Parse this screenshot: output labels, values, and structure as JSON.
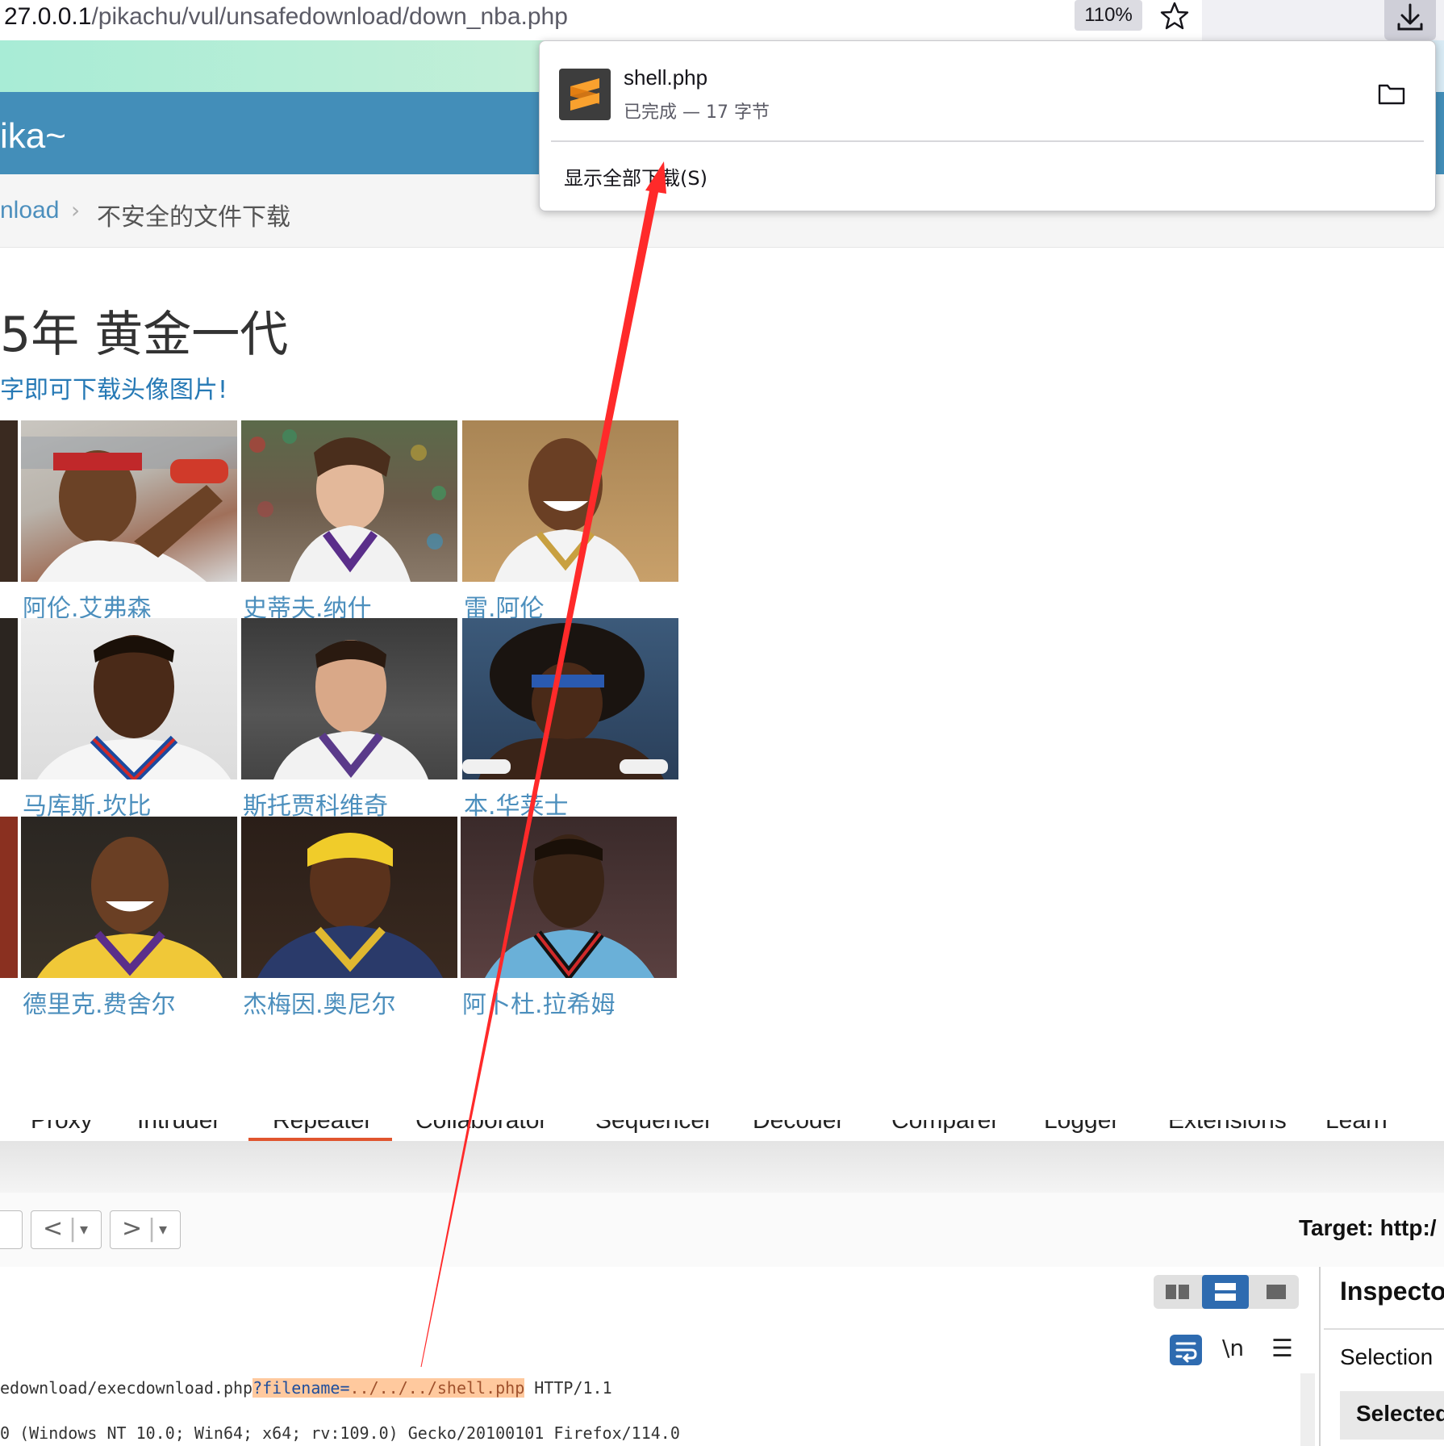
{
  "browser": {
    "url_host": "27.0.0.1",
    "url_path": "/pikachu/vul/unsafedownload/down_nba.php",
    "zoom": "110%",
    "icons": [
      "star-icon",
      "download-icon"
    ]
  },
  "downloads_panel": {
    "file_name": "shell.php",
    "status": "已完成 — 17 字节",
    "show_all": "显示全部下载(S)",
    "icons": [
      "sublime-text-icon",
      "folder-icon"
    ]
  },
  "page": {
    "brand": "ika~",
    "breadcrumb": {
      "parent": "nload",
      "current": "不安全的文件下载"
    },
    "heading": "5年 黄金一代",
    "hint": "字即可下载头像图片!",
    "players": [
      {
        "name": "阿伦.艾弗森"
      },
      {
        "name": "史蒂夫.纳什"
      },
      {
        "name": "雷.阿伦"
      },
      {
        "name": "马库斯.坎比"
      },
      {
        "name": "斯托贾科维奇"
      },
      {
        "name": "本.华莱士"
      },
      {
        "name": "德里克.费舍尔"
      },
      {
        "name": "杰梅因.奥尼尔"
      },
      {
        "name": "阿卜杜.拉希姆"
      }
    ]
  },
  "burp": {
    "tabs": [
      "Proxy",
      "Intruder",
      "Repeater",
      "Collaborator",
      "Sequencer",
      "Decoder",
      "Comparer",
      "Logger",
      "Extensions",
      "Learn"
    ],
    "active_tab": "Repeater",
    "target": "Target: http:/",
    "nav_back": "<",
    "nav_forward": ">",
    "nav_dropdown": "▾",
    "newline_toggle": "\\n",
    "request": {
      "line1_prefix": "edownload/execdownload.php",
      "line1_q": "?",
      "line1_param": "filename",
      "line1_eq": "=",
      "line1_value": "../../../shell.php",
      "line1_suffix": " HTTP/1.1",
      "line2": "0 (Windows NT 10.0; Win64; x64; rv:109.0) Gecko/20100101 Firefox/114.0"
    },
    "inspector": {
      "title": "Inspecto",
      "selection": "Selection",
      "selected": "Selected"
    }
  },
  "colors": {
    "page_header": "#438eb9",
    "link": "#4c8fbd",
    "burp_accent": "#e0552e",
    "annotation_arrow": "#ff2a2a",
    "param_highlight": "#ffc99e"
  }
}
